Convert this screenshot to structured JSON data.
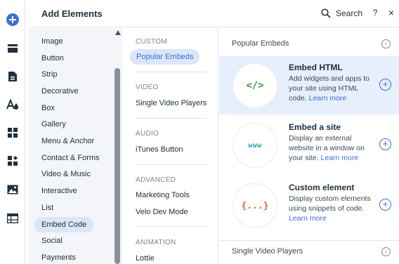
{
  "toolbar": {
    "items": [
      {
        "icon": "plus-icon",
        "active": true
      },
      {
        "icon": "sections-icon"
      },
      {
        "icon": "pages-icon"
      },
      {
        "icon": "design-icon"
      },
      {
        "icon": "apps-icon"
      },
      {
        "icon": "puzzle-icon"
      },
      {
        "icon": "media-icon"
      },
      {
        "icon": "table-icon"
      }
    ]
  },
  "panel": {
    "title": "Add Elements",
    "search_label": "Search",
    "help_label": "?",
    "close_label": "×"
  },
  "categories": [
    {
      "label": "Image"
    },
    {
      "label": "Button"
    },
    {
      "label": "Strip"
    },
    {
      "label": "Decorative"
    },
    {
      "label": "Box"
    },
    {
      "label": "Gallery"
    },
    {
      "label": "Menu & Anchor"
    },
    {
      "label": "Contact & Forms"
    },
    {
      "label": "Video & Music"
    },
    {
      "label": "Interactive"
    },
    {
      "label": "List"
    },
    {
      "label": "Embed Code",
      "selected": true
    },
    {
      "label": "Social"
    },
    {
      "label": "Payments"
    }
  ],
  "sections": {
    "custom": {
      "heading": "CUSTOM",
      "items": [
        "Popular Embeds"
      ]
    },
    "video": {
      "heading": "VIDEO",
      "items": [
        "Single Video Players"
      ]
    },
    "audio": {
      "heading": "AUDIO",
      "items": [
        "iTunes Button"
      ]
    },
    "advanced": {
      "heading": "ADVANCED",
      "items": [
        "Marketing Tools",
        "Velo Dev Mode"
      ]
    },
    "animation": {
      "heading": "ANIMATION",
      "items": [
        "Lottie"
      ]
    }
  },
  "content": {
    "section_title": "Popular Embeds",
    "next_section_title": "Single Video Players",
    "info_glyph": "i",
    "add_glyph": "+",
    "cards": [
      {
        "title": "Embed HTML",
        "description": "Add widgets and apps to your site using HTML code.",
        "link": "Learn more",
        "icon": "code-icon",
        "icon_text": "</>",
        "highlighted": true
      },
      {
        "title": "Embed a site",
        "description": "Display an external website in a window on your site.",
        "link": "Learn more",
        "icon": "www-icon",
        "icon_text": "www"
      },
      {
        "title": "Custom element",
        "description": "Display custom elements using snippets of code.",
        "link": "Learn more",
        "icon": "braces-icon",
        "icon_text": "{...}"
      }
    ]
  },
  "colors": {
    "accent": "#3b6fd4",
    "selected_bg": "#dbe6f8",
    "code_icon": "#3a9b3a",
    "www_icon": "#2f9da8",
    "braces_icon": "#e0682c"
  }
}
